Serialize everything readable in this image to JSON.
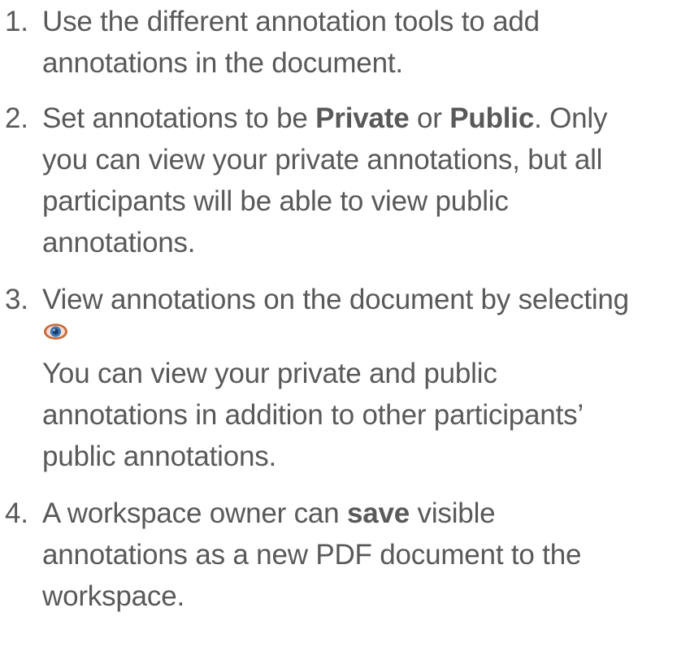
{
  "steps": [
    {
      "number": "1.",
      "lines": [
        "Use the different annotation tools to add",
        "annotations in the document."
      ]
    },
    {
      "number": "2.",
      "line1": {
        "before": "Set annotations to be ",
        "bold1": "Private",
        "middle": " or ",
        "bold2": "Public",
        "after": ". Only"
      },
      "lines": [
        "you can view your private annotations, but all",
        "participants will be able to view public",
        "annotations."
      ]
    },
    {
      "number": "3.",
      "line1": "View annotations on the document by selecting",
      "icon": "eye-icon",
      "lines": [
        "You can view your private and public",
        "annotations in addition to other participants’",
        "public annotations."
      ]
    },
    {
      "number": "4.",
      "line1": {
        "before": "A workspace owner can ",
        "bold": "save",
        "after": " visible"
      },
      "lines": [
        "annotations as a new PDF document to the",
        "workspace."
      ]
    }
  ],
  "colors": {
    "text": "#595959",
    "eye_ring": "#c86a3a",
    "eye_iris": "#3a78b8",
    "eye_pupil": "#1d3c6e"
  }
}
